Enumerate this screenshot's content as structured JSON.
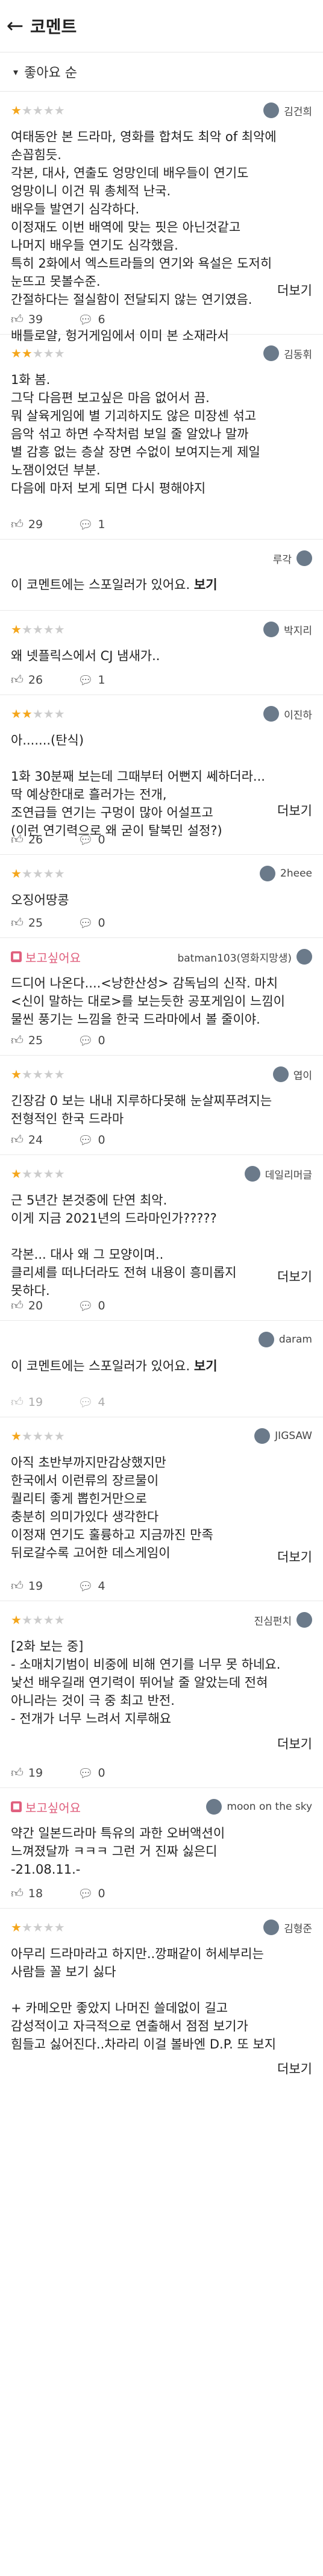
{
  "header": {
    "title": "코멘트"
  },
  "sort": {
    "label": "좋아요 순"
  },
  "colors": {
    "star": "#f4a61c",
    "badge": "#e0607e"
  },
  "comments": [
    {
      "stars": 1,
      "user": "김건희",
      "text": "여태동안 본 드라마, 영화를 합쳐도 최악 of 최악에\n손꼽힘듯.\n각본, 대사, 연출도 엉망인데 배우들이 연기도\n엉망이니 이건 뭐 총체적 난국.\n배우들 발연기 심각하다.\n이정재도 이번 배역에 맞는 핏은 아닌것같고\n나머지 배우들 연기도 심각했음.\n특히 2화에서 엑스트라들의 연기와 욕설은 도저히\n눈뜨고 못볼수준.\n간절하다는 절실함이 전달되지 않는 연기였음.\n\n배틀로얄, 헝거게임에서 이미 본 소재라서",
      "more": "더보기",
      "likes": "39",
      "replies": "6"
    },
    {
      "stars": 2,
      "user": "김동휘",
      "text": "1화 봄.\n그닥 다음편 보고싶은 마음 없어서 끔.\n뭐 살육게임에 별 기괴하지도 않은 미장센 섞고\n음악 섞고 하면 수작처럼 보일 줄 알았나 말까\n별 감흥 없는 층살 장면 수없이 보여지는게 제일\n노잼이었던 부분.\n다음에 마저 보게 되면 다시 평해야지",
      "more": "",
      "likes": "29",
      "replies": "1"
    },
    {
      "stars": 0,
      "user": "루각",
      "text": "이 코멘트에는 스포일러가 있어요.",
      "spoiler": "보기",
      "likes": "",
      "replies": ""
    },
    {
      "stars": 1,
      "user": "박지리",
      "text": "왜 넷플릭스에서 CJ 냄새가..",
      "more": "",
      "likes": "26",
      "replies": "1"
    },
    {
      "stars": 2,
      "user": "이진하",
      "text": "아.......(탄식)\n\n1화 30분째 보는데 그때부터 어뻔지 쎄하더라...\n딱 예상한대로 흘러가는 전개,\n조연급들 연기는 구멍이 많아 어설프고\n(이런 연기력으로 왜 굳이 탈북민 설정?)",
      "more": "더보기",
      "likes": "26",
      "replies": "0"
    },
    {
      "stars": 1,
      "user": "2heee",
      "text": "오징어땅콩",
      "more": "",
      "likes": "25",
      "replies": "0"
    },
    {
      "badge": "보고싶어요",
      "user": "batman103(영화지망생)",
      "text": "드디어 나온다....<낭한산성> 감독님의 신작. 마치\n<신이 말하는 대로>를 보는듯한 공포게임이 느낌이\n물씬 풍기는 느낌을 한국 드라마에서 볼 줄이야.",
      "more": "",
      "likes": "25",
      "replies": "0"
    },
    {
      "stars": 1,
      "user": "엽이",
      "text": "긴장감 0 보는 내내 지루하다못해 눈살찌푸려지는\n전형적인 한국 드라마",
      "more": "",
      "likes": "24",
      "replies": "0"
    },
    {
      "stars": 1,
      "user": "데일리머글",
      "text": "근 5년간 본것중에 단연 최악.\n이게 지금 2021년의 드라마인가?????\n\n각본... 대사 왜 그 모양이며..\n클리셰를 떠나더라도 전혀 내용이 흥미롭지\n못하다.",
      "more": "더보기",
      "likes": "20",
      "replies": "0"
    },
    {
      "stars": 0,
      "user": "daram",
      "text": "이 코멘트에는 스포일러가 있어요.",
      "spoiler": "보기",
      "likes": "19",
      "replies": "4"
    },
    {
      "stars": 1,
      "user": "JIGSAW",
      "text": "아직 초반부까지만감상했지만\n한국에서 이런류의 장르물이\n퀄리티 좋게 뽑힌거만으로\n충분히 의미가있다 생각한다\n이정재 연기도 훌륭하고 지금까진 만족\n뒤로갈수록 고어한 데스게임이",
      "more": "더보기",
      "likes": "19",
      "replies": "4"
    },
    {
      "stars": 1,
      "user": "진심펀치",
      "text": "[2화 보는 중]\n- 소매치기범이 비중에 비해 연기를 너무 못 하네요.\n낯선 배우길래 연기력이 뛰어날 줄 알았는데 전혀\n아니라는 것이 극 중 최고 반전.\n- 전개가 너무 느려서 지루해요",
      "more": "더보기",
      "likes": "19",
      "replies": "0"
    },
    {
      "badge": "보고싶어요",
      "user": "moon on the sky",
      "text": "약간 일본드라마 특유의 과한 오버액션이\n느껴졌달까 ㅋㅋㅋ 그런 거 진짜 싫은디\n-21.08.11.-",
      "more": "",
      "likes": "18",
      "replies": "0"
    },
    {
      "stars": 1,
      "user": "김형준",
      "text": "아무리 드라마라고 하지만..깡패같이 허세부리는\n사람들 꼴 보기 싫다\n\n+ 카메오만 좋았지 나머진 쓸데없이 길고\n감성적이고 자극적으로 연출해서 점점 보기가\n힘들고 싫어진다..차라리 이걸 볼바엔 D.P. 또 보지",
      "more": "더보기",
      "likes": "",
      "replies": ""
    }
  ]
}
